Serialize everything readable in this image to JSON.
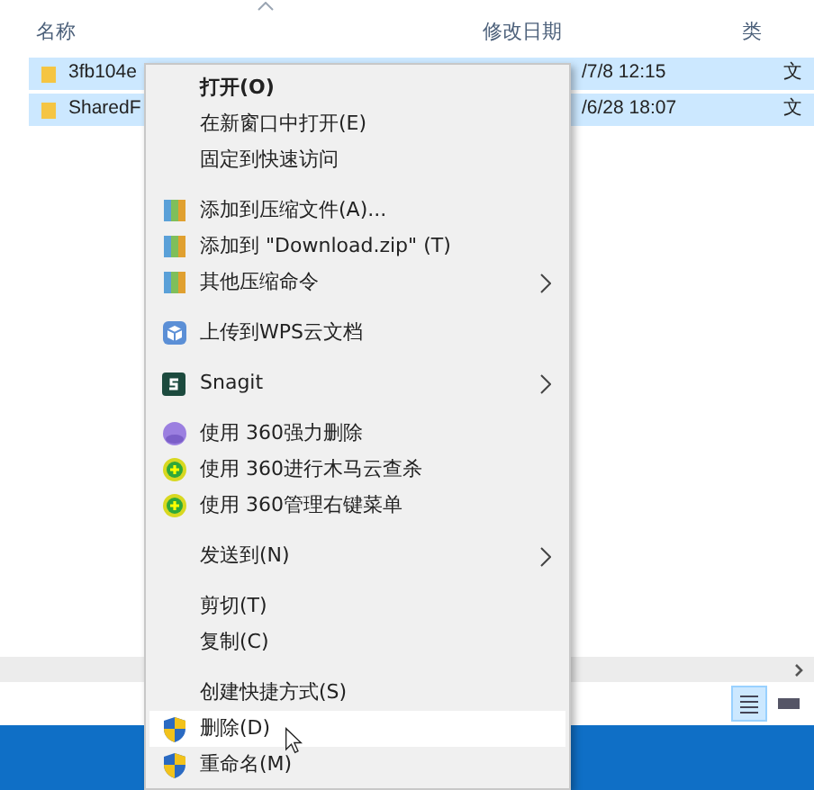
{
  "file_list": {
    "columns": [
      "名称",
      "修改日期",
      "类"
    ],
    "rows": [
      {
        "name": "3fb104e",
        "modified": "/7/8 12:15",
        "type": "文",
        "selected": true
      },
      {
        "name": "SharedF",
        "modified": "/6/28 18:07",
        "type": "文",
        "selected": true
      }
    ]
  },
  "view_buttons": [
    {
      "selected": true
    },
    {
      "selected": false
    }
  ],
  "context_menu": {
    "items": [
      {
        "kind": "plain",
        "label": "打开(O)",
        "default": true,
        "submenu": false,
        "selected": false
      },
      {
        "kind": "plain",
        "label": "在新窗口中打开(E)",
        "default": false,
        "submenu": false,
        "selected": false
      },
      {
        "kind": "plain",
        "label": "固定到快速访问",
        "default": false,
        "submenu": false,
        "selected": false
      },
      {
        "kind": "separator"
      },
      {
        "kind": "archive",
        "label": "添加到压缩文件(A)...",
        "default": false,
        "submenu": false,
        "selected": false
      },
      {
        "kind": "archive",
        "label": "添加到 \"Download.zip\" (T)",
        "default": false,
        "submenu": false,
        "selected": false
      },
      {
        "kind": "archive",
        "label": "其他压缩命令",
        "default": false,
        "submenu": true,
        "selected": false
      },
      {
        "kind": "separator"
      },
      {
        "kind": "cloud",
        "label": "上传到WPS云文档",
        "default": false,
        "submenu": false,
        "selected": false
      },
      {
        "kind": "separator"
      },
      {
        "kind": "snagit",
        "label": "Snagit",
        "default": false,
        "submenu": true,
        "selected": false
      },
      {
        "kind": "separator"
      },
      {
        "kind": "purge",
        "label": "使用 360强力删除",
        "default": false,
        "submenu": false,
        "selected": false
      },
      {
        "kind": "scan",
        "label": "使用 360进行木马云查杀",
        "default": false,
        "submenu": false,
        "selected": false
      },
      {
        "kind": "scan",
        "label": "使用 360管理右键菜单",
        "default": false,
        "submenu": false,
        "selected": false
      },
      {
        "kind": "separator"
      },
      {
        "kind": "plain",
        "label": "发送到(N)",
        "default": false,
        "submenu": true,
        "selected": false
      },
      {
        "kind": "separator"
      },
      {
        "kind": "plain",
        "label": "剪切(T)",
        "default": false,
        "submenu": false,
        "selected": false
      },
      {
        "kind": "plain",
        "label": "复制(C)",
        "default": false,
        "submenu": false,
        "selected": false
      },
      {
        "kind": "separator"
      },
      {
        "kind": "plain",
        "label": "创建快捷方式(S)",
        "default": false,
        "submenu": false,
        "selected": false
      },
      {
        "kind": "shield",
        "label": "删除(D)",
        "default": false,
        "submenu": false,
        "selected": true
      },
      {
        "kind": "shield",
        "label": "重命名(M)",
        "default": false,
        "submenu": false,
        "selected": false
      }
    ]
  }
}
